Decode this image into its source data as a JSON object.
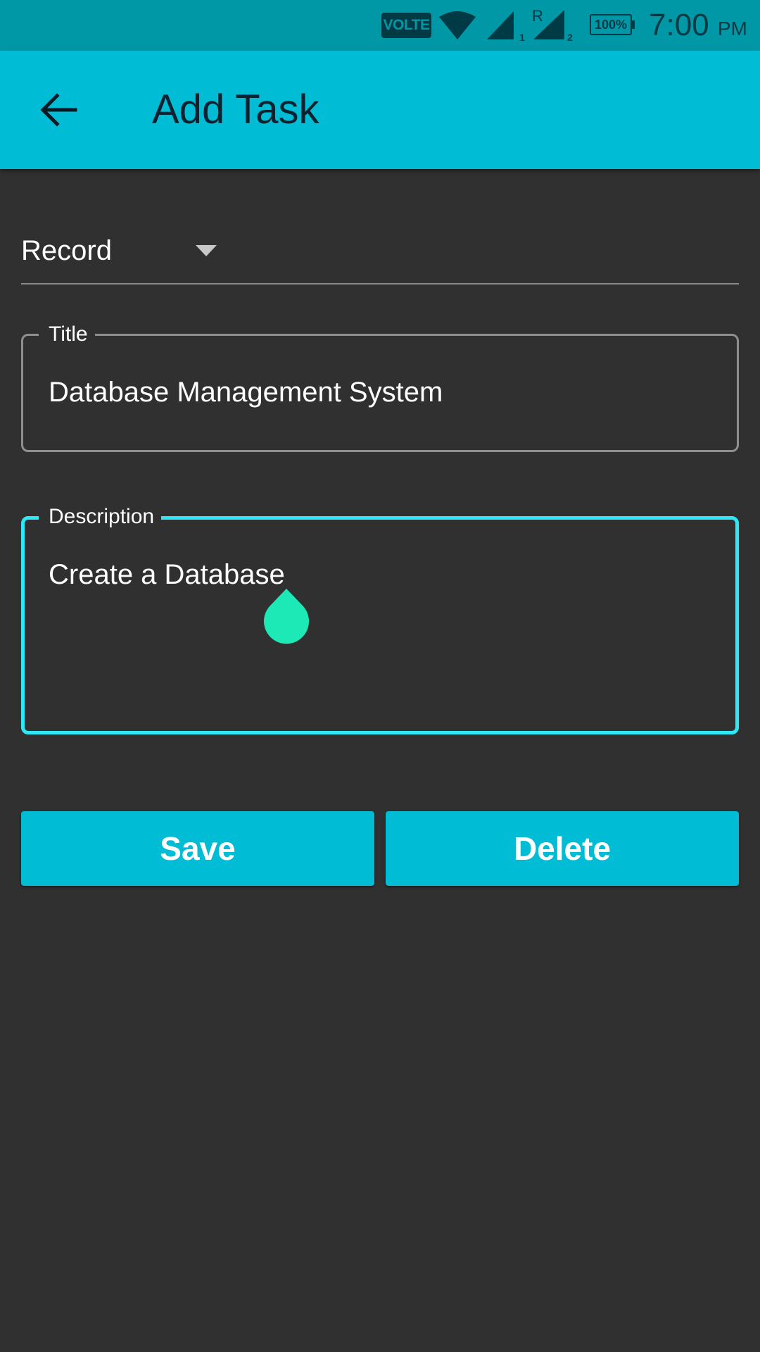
{
  "status_bar": {
    "volte": "VOLTE",
    "sim1_label": "1",
    "sim2_roaming": "R",
    "sim2_label": "2",
    "battery": "100%",
    "time": "7:00",
    "ampm": "PM"
  },
  "app_bar": {
    "title": "Add Task",
    "back_icon": "arrow-back-icon"
  },
  "form": {
    "category_selected": "Record",
    "title_label": "Title",
    "title_value": "Database Management System",
    "description_label": "Description",
    "description_value": "Create a Database"
  },
  "actions": {
    "save_label": "Save",
    "delete_label": "Delete"
  },
  "colors": {
    "status_bar": "#0097a7",
    "app_bar": "#00bcd4",
    "background": "#303030",
    "focus_outline": "#30e8f5",
    "cursor_handle": "#1de9b6",
    "button": "#00bcd4"
  }
}
